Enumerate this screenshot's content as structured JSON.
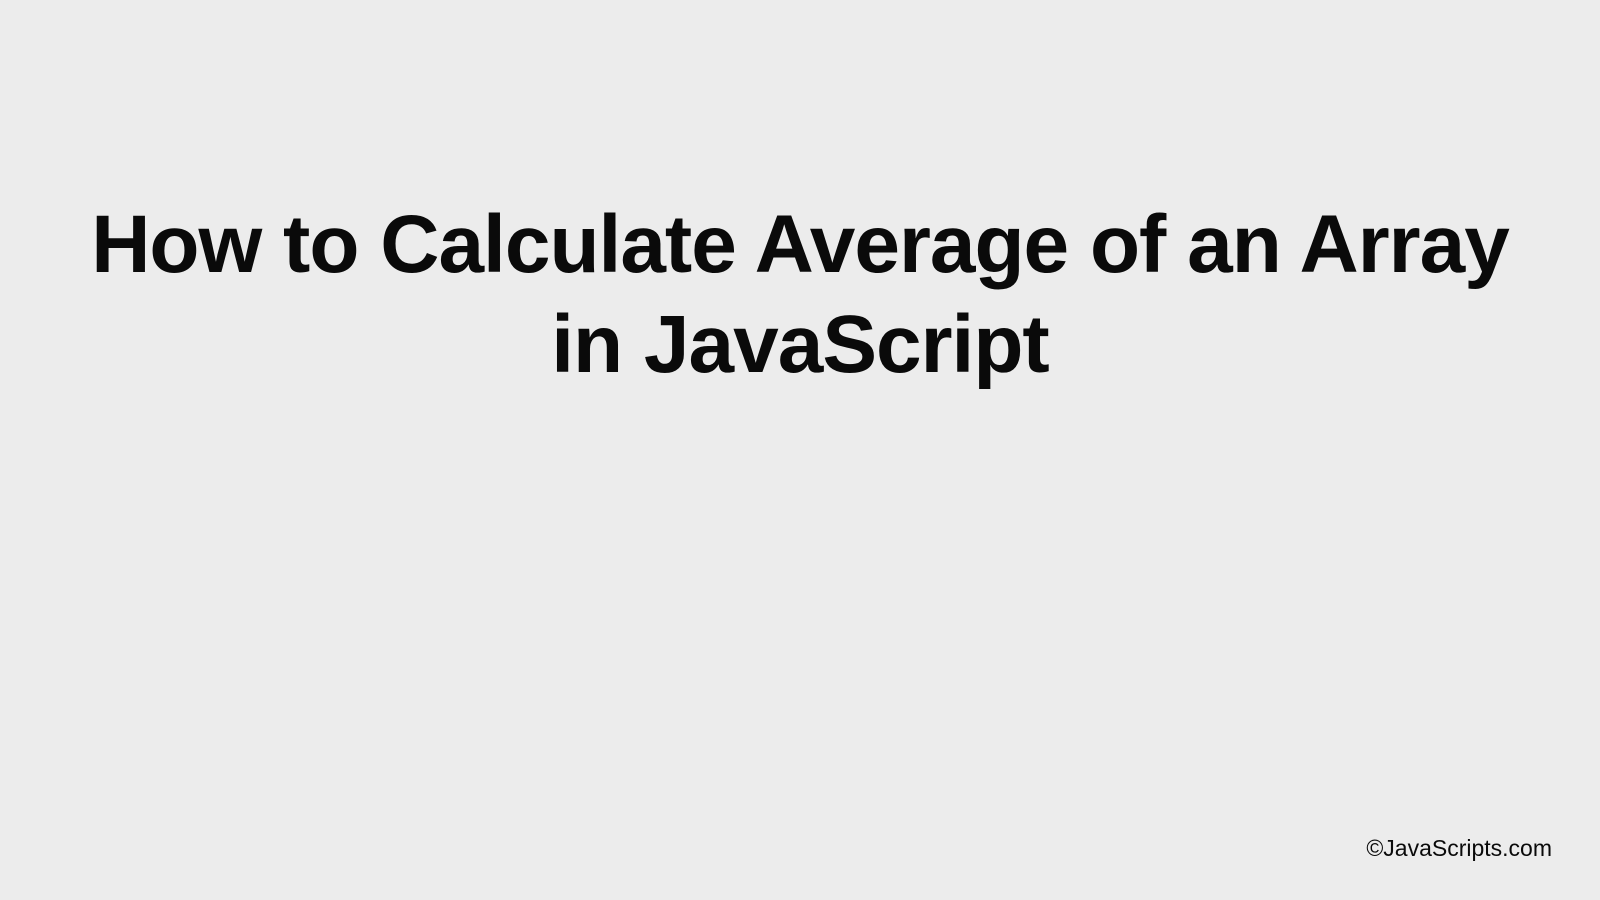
{
  "title": "How to Calculate Average of an Array in JavaScript",
  "footer": "©JavaScripts.com"
}
